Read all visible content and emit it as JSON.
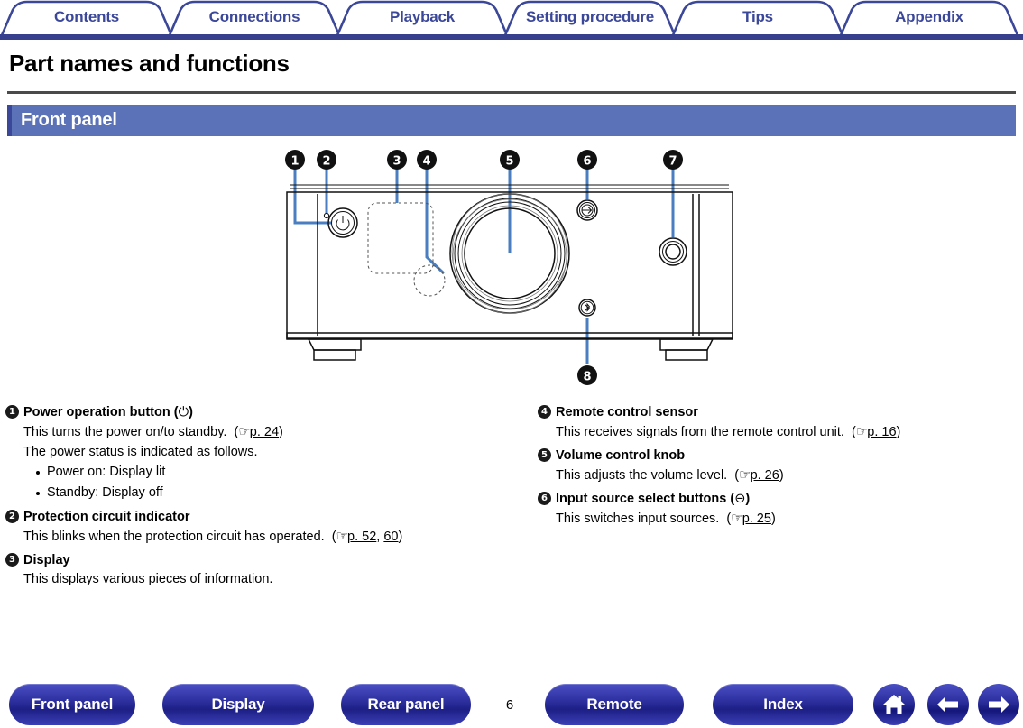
{
  "tabs": [
    {
      "label": "Contents"
    },
    {
      "label": "Connections"
    },
    {
      "label": "Playback"
    },
    {
      "label": "Setting procedure"
    },
    {
      "label": "Tips"
    },
    {
      "label": "Appendix"
    }
  ],
  "page": {
    "title": "Part names and functions",
    "section_title": "Front panel"
  },
  "diagram": {
    "name": "front-panel-illustration",
    "callouts": [
      "1",
      "2",
      "3",
      "4",
      "5",
      "6",
      "7",
      "8"
    ],
    "power_symbol": "⏻",
    "input_symbol": "⊖",
    "bluetooth_symbol": "ᛦ"
  },
  "descriptions": {
    "left": [
      {
        "num": "❶",
        "title": "Power operation button (⏻)",
        "title_plain": "Power operation button",
        "title_icon": "power-icon",
        "lines": [
          {
            "text": "This turns the power on/to standby.",
            "ref_hand": "☞",
            "ref": "p. 24",
            "ref_tail": ""
          },
          {
            "text": "The power status is indicated as follows."
          }
        ],
        "bullets": [
          "Power on: Display lit",
          "Standby: Display off"
        ]
      },
      {
        "num": "❷",
        "title": "Protection circuit indicator",
        "title_plain": "Protection circuit indicator",
        "lines": [
          {
            "text": "This blinks when the protection circuit has operated.",
            "ref_hand": "☞",
            "ref": "p. 52",
            "ref_tail": ",",
            "ref2": "60"
          }
        ],
        "bullets": []
      },
      {
        "num": "❸",
        "title": "Display",
        "title_plain": "Display",
        "lines": [
          {
            "text": "This displays various pieces of information."
          }
        ],
        "bullets": []
      }
    ],
    "right": [
      {
        "num": "❹",
        "title": "Remote control sensor",
        "title_plain": "Remote control sensor",
        "lines": [
          {
            "text": "This receives signals from the remote control unit.",
            "ref_hand": "☞",
            "ref": "p. 16"
          }
        ],
        "bullets": []
      },
      {
        "num": "❺",
        "title": "Volume control knob",
        "title_plain": "Volume control knob",
        "lines": [
          {
            "text": "This adjusts the volume level.",
            "ref_hand": "☞",
            "ref": "p. 26"
          }
        ],
        "bullets": []
      },
      {
        "num": "❻",
        "title": "Input source select buttons (⊖)",
        "title_plain": "Input source select buttons",
        "title_icon": "input-source-icon",
        "lines": [
          {
            "text": "This switches input sources.",
            "ref_hand": "☞",
            "ref": "p. 25"
          }
        ],
        "bullets": []
      }
    ]
  },
  "footer": {
    "buttons": [
      {
        "label": "Front panel"
      },
      {
        "label": "Display"
      },
      {
        "label": "Rear panel"
      },
      {
        "label": "Remote"
      },
      {
        "label": "Index"
      }
    ],
    "page_number": "6",
    "icons": [
      {
        "name": "home-icon"
      },
      {
        "name": "arrow-left-icon"
      },
      {
        "name": "arrow-right-icon"
      }
    ]
  },
  "colors": {
    "tab_text": "#3b4799",
    "tab_rule": "#36408c",
    "section_bar": "#5b72b8",
    "section_accent": "#3b4799",
    "title_rule": "#4a4a4a",
    "leader_line": "#4a7ec0",
    "callout_dot": "#111111",
    "footer_button": "#2d2f9e"
  }
}
